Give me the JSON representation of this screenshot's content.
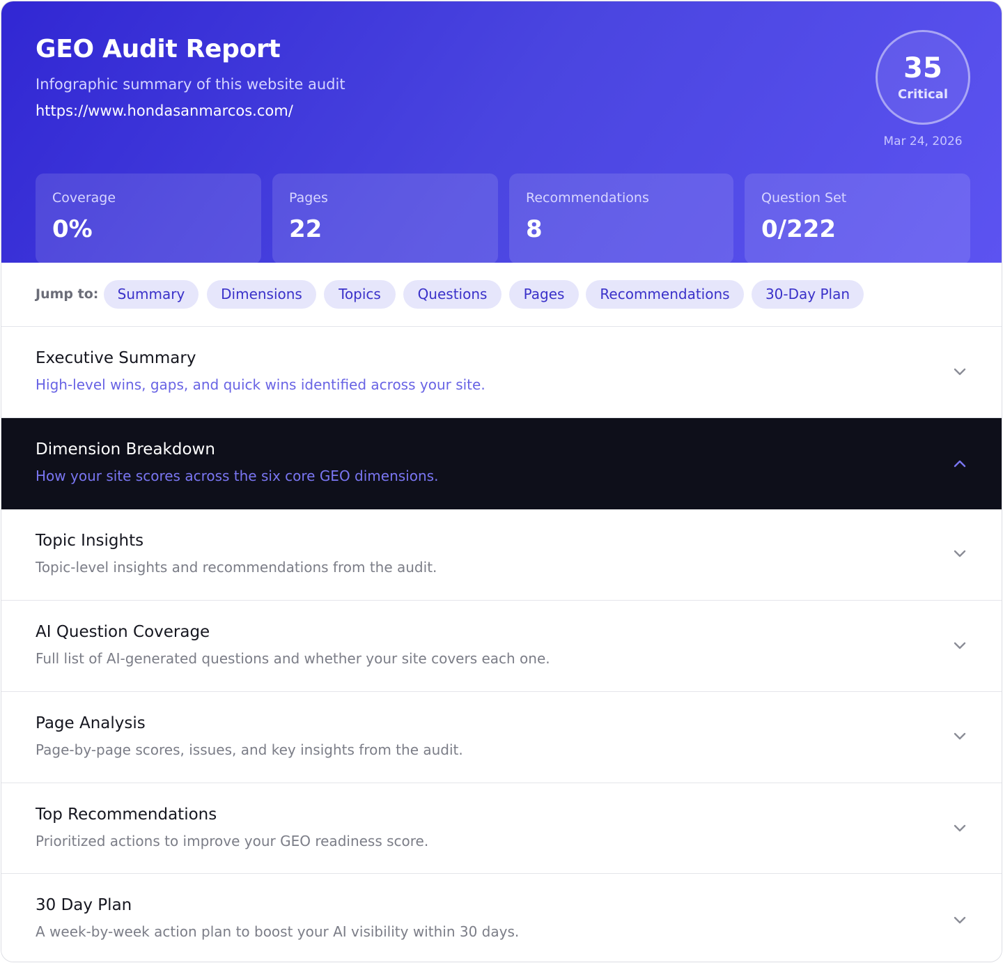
{
  "header": {
    "title": "GEO Audit Report",
    "subtitle": "Infographic summary of this website audit",
    "url": "https://www.hondasanmarcos.com/",
    "score": "35",
    "score_label": "Critical",
    "date": "Mar 24, 2026"
  },
  "stats": [
    {
      "label": "Coverage",
      "value": "0%"
    },
    {
      "label": "Pages",
      "value": "22"
    },
    {
      "label": "Recommendations",
      "value": "8"
    },
    {
      "label": "Question Set",
      "value": "0/222"
    }
  ],
  "jump": {
    "label": "Jump to:",
    "links": [
      "Summary",
      "Dimensions",
      "Topics",
      "Questions",
      "Pages",
      "Recommendations",
      "30-Day Plan"
    ]
  },
  "sections": [
    {
      "title": "Executive Summary",
      "desc": "High-level wins, gaps, and quick wins identified across your site.",
      "expanded": false,
      "chevron": "chevron-down-icon"
    },
    {
      "title": "Dimension Breakdown",
      "desc": "How your site scores across the six core GEO dimensions.",
      "expanded": true,
      "chevron": "chevron-up-icon"
    },
    {
      "title": "Topic Insights",
      "desc": "Topic-level insights and recommendations from the audit.",
      "expanded": false,
      "chevron": "chevron-down-icon"
    },
    {
      "title": "AI Question Coverage",
      "desc": "Full list of AI-generated questions and whether your site covers each one.",
      "expanded": false,
      "chevron": "chevron-down-icon"
    },
    {
      "title": "Page Analysis",
      "desc": "Page-by-page scores, issues, and key insights from the audit.",
      "expanded": false,
      "chevron": "chevron-down-icon"
    },
    {
      "title": "Top Recommendations",
      "desc": "Prioritized actions to improve your GEO readiness score.",
      "expanded": false,
      "chevron": "chevron-down-icon"
    },
    {
      "title": "30 Day Plan",
      "desc": "A week-by-week action plan to boost your AI visibility within 30 days.",
      "expanded": false,
      "chevron": "chevron-down-icon"
    }
  ],
  "colors": {
    "accent": "#4a45e0",
    "active_section_bg": "#0e0f1a",
    "chip_bg": "#e6e6fb",
    "chip_text": "#3a31c9"
  }
}
